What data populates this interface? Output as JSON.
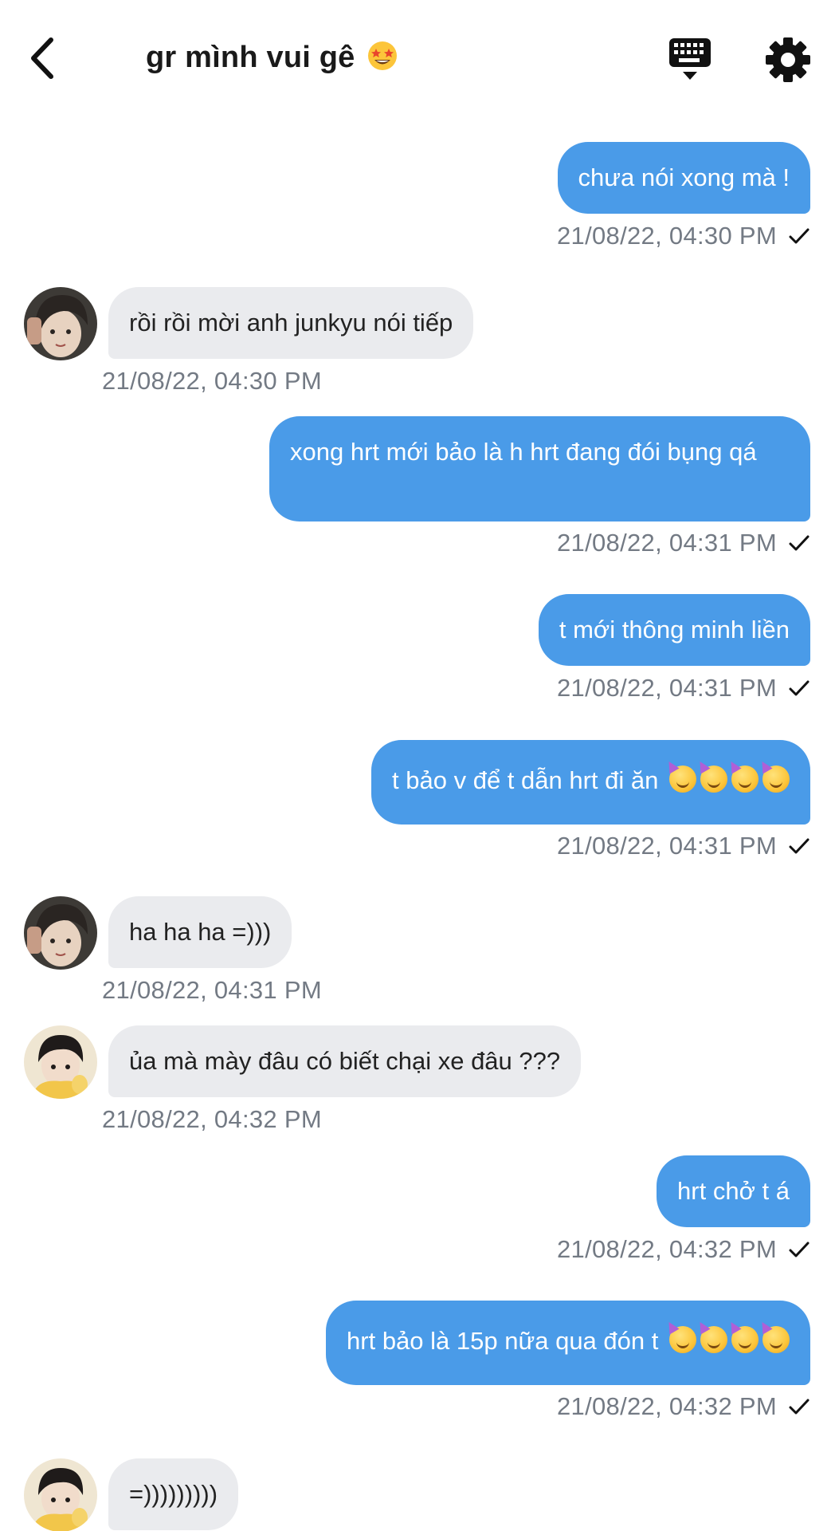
{
  "header": {
    "title": "gr mình vui gê",
    "title_emoji_icon": "star-struck-emoji-icon",
    "back_icon": "chevron-left-icon",
    "keyboard_icon": "keyboard-hide-icon",
    "settings_icon": "gear-icon"
  },
  "colors": {
    "outgoing_bubble": "#4a9be8",
    "incoming_bubble": "#eaebee",
    "timestamp": "#737a84"
  },
  "messages": [
    {
      "direction": "out",
      "text": "chưa nói xong mà !",
      "time": "21/08/22, 04:30 PM",
      "status_icon": "checkmark-icon"
    },
    {
      "direction": "in",
      "sender_avatar": "avatar-1",
      "text": "rồi rồi mời anh junkyu nói tiếp",
      "time": "21/08/22, 04:30 PM"
    },
    {
      "direction": "out",
      "text": "xong hrt mới bảo là h hrt đang đói bụng qá",
      "time": "21/08/22, 04:31 PM",
      "status_icon": "checkmark-icon"
    },
    {
      "direction": "out",
      "text": "t mới thông minh liền",
      "time": "21/08/22, 04:31 PM",
      "status_icon": "checkmark-icon"
    },
    {
      "direction": "out",
      "text": "t bảo v để t dẫn hrt đi ăn",
      "emoji_count": 4,
      "emoji_icon": "partying-face-emoji-icon",
      "time": "21/08/22, 04:31 PM",
      "status_icon": "checkmark-icon"
    },
    {
      "direction": "in",
      "sender_avatar": "avatar-1",
      "text": "ha ha ha =)))",
      "time": "21/08/22, 04:31 PM"
    },
    {
      "direction": "in",
      "sender_avatar": "avatar-2",
      "text": "ủa mà mày đâu có biết chại xe đâu ???",
      "time": "21/08/22, 04:32 PM"
    },
    {
      "direction": "out",
      "text": "hrt chở t á",
      "time": "21/08/22, 04:32 PM",
      "status_icon": "checkmark-icon"
    },
    {
      "direction": "out",
      "text": "hrt bảo là 15p nữa qua đón t",
      "emoji_count": 4,
      "emoji_icon": "partying-face-emoji-icon",
      "time": "21/08/22, 04:32 PM",
      "status_icon": "checkmark-icon"
    },
    {
      "direction": "in",
      "sender_avatar": "avatar-2",
      "text": "=)))))))))"
    }
  ]
}
